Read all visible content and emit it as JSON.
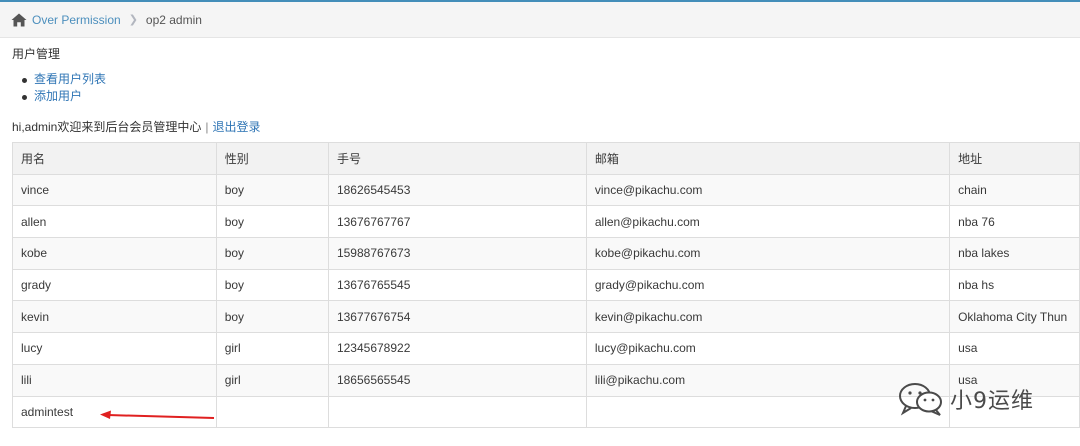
{
  "breadcrumb": {
    "home_label": "Over Permission",
    "current": "op2 admin"
  },
  "section": {
    "title": "用户管理",
    "menu": [
      "查看用户列表",
      "添加用户"
    ]
  },
  "welcome": {
    "text": "hi,admin欢迎来到后台会员管理中心",
    "separator": "|",
    "logout": "退出登录"
  },
  "table": {
    "headers": [
      "用名",
      "性别",
      "手号",
      "邮箱",
      "地址"
    ],
    "rows": [
      [
        "vince",
        "boy",
        "18626545453",
        "vince@pikachu.com",
        "chain"
      ],
      [
        "allen",
        "boy",
        "13676767767",
        "allen@pikachu.com",
        "nba 76"
      ],
      [
        "kobe",
        "boy",
        "15988767673",
        "kobe@pikachu.com",
        "nba lakes"
      ],
      [
        "grady",
        "boy",
        "13676765545",
        "grady@pikachu.com",
        "nba hs"
      ],
      [
        "kevin",
        "boy",
        "13677676754",
        "kevin@pikachu.com",
        "Oklahoma City Thun"
      ],
      [
        "lucy",
        "girl",
        "12345678922",
        "lucy@pikachu.com",
        "usa"
      ],
      [
        "lili",
        "girl",
        "18656565545",
        "lili@pikachu.com",
        "usa"
      ],
      [
        "admintest",
        "",
        "",
        "",
        ""
      ]
    ]
  },
  "annotation": {
    "arrow_color": "#e02020"
  },
  "watermark": {
    "text": "小9运维",
    "icon": "wechat-icon"
  }
}
